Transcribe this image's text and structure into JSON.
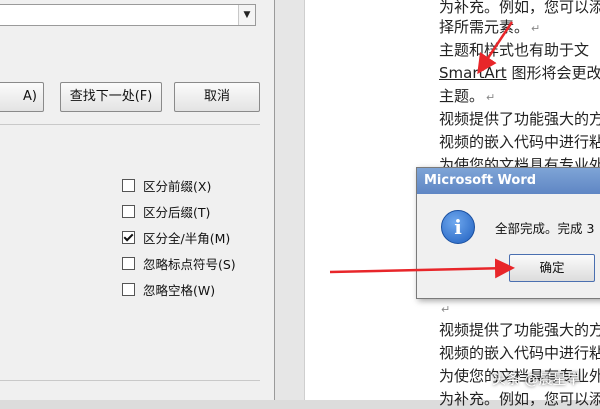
{
  "find_replace_dialog": {
    "replace_all_label": "A)",
    "find_next_label": "查找下一处(F)",
    "cancel_label": "取消",
    "options": [
      {
        "label": "区分前缀(X)",
        "checked": false
      },
      {
        "label": "区分后缀(T)",
        "checked": false
      },
      {
        "label": "区分全/半角(M)",
        "checked": true
      },
      {
        "label": "忽略标点符号(S)",
        "checked": false
      },
      {
        "label": "忽略空格(W)",
        "checked": false
      }
    ]
  },
  "document": {
    "lines": [
      {
        "text": "为补充。例如，您可以添"
      },
      {
        "text": "择所需元素。"
      },
      {
        "text": "主题和样式也有助于文"
      },
      {
        "text": "SmartArt",
        "rest": " 图形将会更改"
      },
      {
        "text": "主题。"
      },
      {
        "text": "视频提供了功能强大的方"
      },
      {
        "text": "视频的嵌入代码中进行粘"
      },
      {
        "text": "为使您的文档具有专业外"
      },
      {
        "text": "视频提供了功能强大的方"
      },
      {
        "text": "视频的嵌入代码中进行粘"
      },
      {
        "text": "为使您的文档具有专业外"
      },
      {
        "text": "为补充。例如，您可以添"
      }
    ],
    "paragraph_mark": "↵"
  },
  "message_box": {
    "title": "Microsoft Word",
    "message": "全部完成。完成 3",
    "ok_label": "确定",
    "icon": "info-icon"
  },
  "watermark": "头条 @晨星早",
  "colors": {
    "arrow": "#e8262a",
    "titlebar": "#6a90cc"
  }
}
